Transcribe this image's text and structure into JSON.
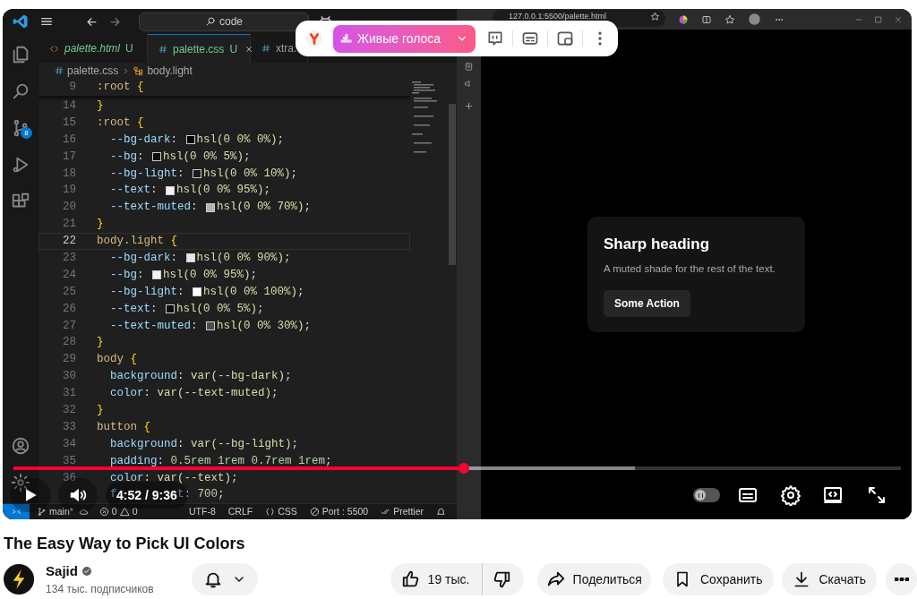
{
  "video": {
    "editor": {
      "search": "code",
      "tabs": [
        {
          "label": "palette.html",
          "badge": "U",
          "selected": false,
          "preview": true,
          "kind": "html"
        },
        {
          "label": "palette.css",
          "badge": "U",
          "selected": true,
          "preview": false,
          "kind": "css"
        },
        {
          "label": "xtra.",
          "selected": false,
          "preview": false,
          "kind": "css"
        }
      ],
      "breadcrumb": {
        "file": "palette.css",
        "symbol": "body.light"
      },
      "source_control_badge": "8",
      "sticky_line": {
        "n": "9",
        "tokens": [
          {
            "kind": "sel",
            "text": ":root "
          },
          {
            "kind": "brace",
            "text": "{"
          }
        ]
      },
      "lines": [
        {
          "n": "14",
          "current": false,
          "tokens": [
            {
              "kind": "brace",
              "text": "}"
            }
          ]
        },
        {
          "n": "15",
          "current": false,
          "tokens": [
            {
              "kind": "sel",
              "text": ":root "
            },
            {
              "kind": "brace",
              "text": "{"
            }
          ]
        },
        {
          "n": "16",
          "current": false,
          "tokens": [
            {
              "kind": "prop",
              "text": "  --bg-dark"
            },
            {
              "kind": "punc",
              "text": ": "
            },
            {
              "kind": "swatch",
              "color": "#000000"
            },
            {
              "kind": "val",
              "text": "hsl(0 0% 0%)"
            },
            {
              "kind": "punc",
              "text": ";"
            }
          ]
        },
        {
          "n": "17",
          "current": false,
          "tokens": [
            {
              "kind": "prop",
              "text": "  --bg"
            },
            {
              "kind": "punc",
              "text": ": "
            },
            {
              "kind": "swatch",
              "color": "#0d0d0d"
            },
            {
              "kind": "val",
              "text": "hsl(0 0% 5%)"
            },
            {
              "kind": "punc",
              "text": ";"
            }
          ]
        },
        {
          "n": "18",
          "current": false,
          "tokens": [
            {
              "kind": "prop",
              "text": "  --bg-light"
            },
            {
              "kind": "punc",
              "text": ": "
            },
            {
              "kind": "swatch",
              "color": "#1a1a1a"
            },
            {
              "kind": "val",
              "text": "hsl(0 0% 10%)"
            },
            {
              "kind": "punc",
              "text": ";"
            }
          ]
        },
        {
          "n": "19",
          "current": false,
          "tokens": [
            {
              "kind": "prop",
              "text": "  --text"
            },
            {
              "kind": "punc",
              "text": ": "
            },
            {
              "kind": "swatch",
              "color": "#f2f2f2"
            },
            {
              "kind": "val",
              "text": "hsl(0 0% 95%)"
            },
            {
              "kind": "punc",
              "text": ";"
            }
          ]
        },
        {
          "n": "20",
          "current": false,
          "tokens": [
            {
              "kind": "prop",
              "text": "  --text-muted"
            },
            {
              "kind": "punc",
              "text": ": "
            },
            {
              "kind": "swatch",
              "color": "#b3b3b3"
            },
            {
              "kind": "val",
              "text": "hsl(0 0% 70%)"
            },
            {
              "kind": "punc",
              "text": ";"
            }
          ]
        },
        {
          "n": "21",
          "current": false,
          "tokens": [
            {
              "kind": "brace",
              "text": "}"
            }
          ]
        },
        {
          "n": "22",
          "current": true,
          "tokens": [
            {
              "kind": "sel",
              "text": "body.light "
            },
            {
              "kind": "brace",
              "text": "{"
            }
          ]
        },
        {
          "n": "23",
          "current": false,
          "tokens": [
            {
              "kind": "prop",
              "text": "  --bg-dark"
            },
            {
              "kind": "punc",
              "text": ": "
            },
            {
              "kind": "swatch",
              "color": "#e6e6e6"
            },
            {
              "kind": "val",
              "text": "hsl(0 0% 90%)"
            },
            {
              "kind": "punc",
              "text": ";"
            }
          ]
        },
        {
          "n": "24",
          "current": false,
          "tokens": [
            {
              "kind": "prop",
              "text": "  --bg"
            },
            {
              "kind": "punc",
              "text": ": "
            },
            {
              "kind": "swatch",
              "color": "#f2f2f2"
            },
            {
              "kind": "val",
              "text": "hsl(0 0% 95%)"
            },
            {
              "kind": "punc",
              "text": ";"
            }
          ]
        },
        {
          "n": "25",
          "current": false,
          "tokens": [
            {
              "kind": "prop",
              "text": "  --bg-light"
            },
            {
              "kind": "punc",
              "text": ": "
            },
            {
              "kind": "swatch",
              "color": "#ffffff"
            },
            {
              "kind": "val",
              "text": "hsl(0 0% 100%)"
            },
            {
              "kind": "punc",
              "text": ";"
            }
          ]
        },
        {
          "n": "26",
          "current": false,
          "tokens": [
            {
              "kind": "prop",
              "text": "  --text"
            },
            {
              "kind": "punc",
              "text": ": "
            },
            {
              "kind": "swatch",
              "color": "#0d0d0d"
            },
            {
              "kind": "val",
              "text": "hsl(0 0% 5%)"
            },
            {
              "kind": "punc",
              "text": ";"
            }
          ]
        },
        {
          "n": "27",
          "current": false,
          "tokens": [
            {
              "kind": "prop",
              "text": "  --text-muted"
            },
            {
              "kind": "punc",
              "text": ": "
            },
            {
              "kind": "swatch",
              "color": "#4d4d4d"
            },
            {
              "kind": "val",
              "text": "hsl(0 0% 30%)"
            },
            {
              "kind": "punc",
              "text": ";"
            }
          ]
        },
        {
          "n": "28",
          "current": false,
          "tokens": [
            {
              "kind": "brace",
              "text": "}"
            }
          ]
        },
        {
          "n": "29",
          "current": false,
          "tokens": [
            {
              "kind": "sel",
              "text": "body "
            },
            {
              "kind": "brace",
              "text": "{"
            }
          ]
        },
        {
          "n": "30",
          "current": false,
          "tokens": [
            {
              "kind": "prop",
              "text": "  background"
            },
            {
              "kind": "punc",
              "text": ": "
            },
            {
              "kind": "val",
              "text": "var(--bg-dark)"
            },
            {
              "kind": "punc",
              "text": ";"
            }
          ]
        },
        {
          "n": "31",
          "current": false,
          "tokens": [
            {
              "kind": "prop",
              "text": "  color"
            },
            {
              "kind": "punc",
              "text": ": "
            },
            {
              "kind": "val",
              "text": "var(--text-muted)"
            },
            {
              "kind": "punc",
              "text": ";"
            }
          ]
        },
        {
          "n": "32",
          "current": false,
          "tokens": [
            {
              "kind": "brace",
              "text": "}"
            }
          ]
        },
        {
          "n": "33",
          "current": false,
          "tokens": [
            {
              "kind": "sel",
              "text": "button "
            },
            {
              "kind": "brace",
              "text": "{"
            }
          ]
        },
        {
          "n": "34",
          "current": false,
          "tokens": [
            {
              "kind": "prop",
              "text": "  background"
            },
            {
              "kind": "punc",
              "text": ": "
            },
            {
              "kind": "val",
              "text": "var(--bg-light)"
            },
            {
              "kind": "punc",
              "text": ";"
            }
          ]
        },
        {
          "n": "35",
          "current": false,
          "tokens": [
            {
              "kind": "prop",
              "text": "  padding"
            },
            {
              "kind": "punc",
              "text": ": "
            },
            {
              "kind": "num",
              "text": "0.5rem 1rem 0.7rem 1rem"
            },
            {
              "kind": "punc",
              "text": ";"
            }
          ]
        },
        {
          "n": "36",
          "current": false,
          "tokens": [
            {
              "kind": "prop",
              "text": "  color"
            },
            {
              "kind": "punc",
              "text": ": "
            },
            {
              "kind": "val",
              "text": "var(--text)"
            },
            {
              "kind": "punc",
              "text": ";"
            }
          ]
        },
        {
          "current": false,
          "tokens": [
            {
              "kind": "prop",
              "text": "  f"
            },
            {
              "kind": "covered"
            },
            {
              "kind": "prop",
              "text": "t"
            },
            {
              "kind": "punc",
              "text": ": "
            },
            {
              "kind": "num",
              "text": "700"
            },
            {
              "kind": "punc",
              "text": ";"
            }
          ]
        }
      ],
      "status_bar": {
        "branch": "main*",
        "errors": "0",
        "warnings": "0",
        "encoding": "UTF-8",
        "eol": "CRLF",
        "language": "CSS",
        "port": "Port : 5500",
        "formatter": "Prettier"
      }
    },
    "browser": {
      "url": "127.0.0.1:5500/palette.html",
      "card": {
        "heading": "Sharp heading",
        "text": "A muted shade for the rest of the text.",
        "button": "Some Action"
      }
    },
    "voice_bar": {
      "button": "Живые голоса"
    },
    "player": {
      "progress": {
        "level": 0.508
      },
      "buffered": {
        "level": 0.7
      },
      "time": "4:52 / 9:36",
      "autoplay": {
        "on": false
      }
    }
  },
  "title": "The Easy Way to Pick UI Colors",
  "channel": {
    "name": "Sajid",
    "verified": true,
    "subscribers": "134 тыс. подписчиков"
  },
  "actions": {
    "likes": "19 тыс.",
    "share": "Поделиться",
    "save": "Сохранить",
    "download": "Скачать"
  }
}
